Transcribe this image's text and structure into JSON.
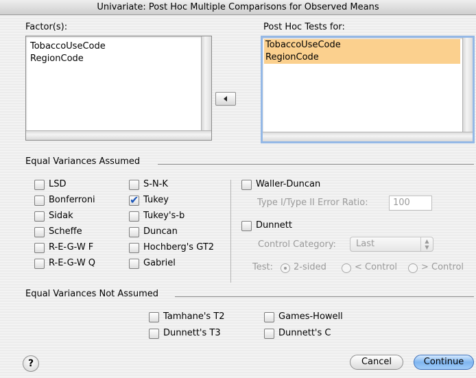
{
  "window": {
    "title": "Univariate: Post Hoc Multiple Comparisons for Observed Means"
  },
  "factors": {
    "label": "Factor(s):",
    "items": [
      "TobaccoUseCode",
      "RegionCode"
    ]
  },
  "move_button": {
    "icon": "left-arrow-icon"
  },
  "posthoc": {
    "label": "Post Hoc Tests for:",
    "items": [
      "TobaccoUseCode",
      "RegionCode"
    ]
  },
  "equal_assumed": {
    "heading": "Equal Variances Assumed",
    "col1": [
      {
        "label": "LSD",
        "checked": false
      },
      {
        "label": "Bonferroni",
        "checked": false
      },
      {
        "label": "Sidak",
        "checked": false
      },
      {
        "label": "Scheffe",
        "checked": false
      },
      {
        "label": "R-E-G-W F",
        "checked": false
      },
      {
        "label": "R-E-G-W Q",
        "checked": false
      }
    ],
    "col2": [
      {
        "label": "S-N-K",
        "checked": false
      },
      {
        "label": "Tukey",
        "checked": true
      },
      {
        "label": "Tukey's-b",
        "checked": false
      },
      {
        "label": "Duncan",
        "checked": false
      },
      {
        "label": "Hochberg's GT2",
        "checked": false
      },
      {
        "label": "Gabriel",
        "checked": false
      }
    ],
    "waller": {
      "label": "Waller-Duncan",
      "checked": false,
      "ratio_label": "Type I/Type II Error Ratio:",
      "ratio_value": "100"
    },
    "dunnett": {
      "label": "Dunnett",
      "checked": false,
      "control_label": "Control Category:",
      "control_value": "Last",
      "test_label": "Test:",
      "options": [
        "2-sided",
        "< Control",
        "> Control"
      ],
      "selected": "2-sided"
    }
  },
  "equal_not_assumed": {
    "heading": "Equal Variances Not Assumed",
    "options": [
      {
        "label": "Tamhane's T2",
        "checked": false
      },
      {
        "label": "Games-Howell",
        "checked": false
      },
      {
        "label": "Dunnett's T3",
        "checked": false
      },
      {
        "label": "Dunnett's C",
        "checked": false
      }
    ]
  },
  "footer": {
    "help_icon": "?",
    "cancel": "Cancel",
    "continue": "Continue"
  }
}
